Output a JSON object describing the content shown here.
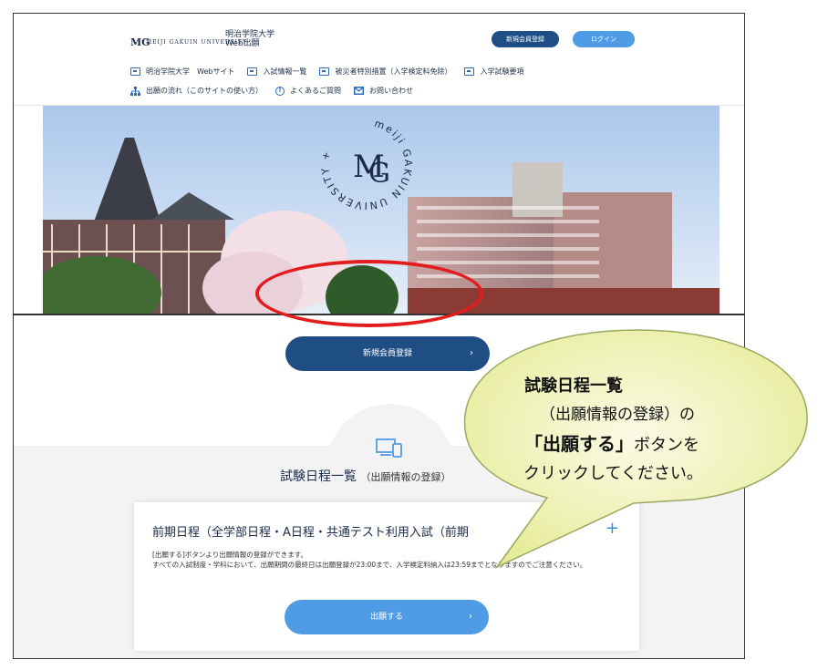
{
  "header": {
    "logo_mark": "MG",
    "logo_text": "MEIJI GAKUIN UNIVERSITY",
    "site_title": "明治学院大学\nWeb出願",
    "register_button": "新規会員登録",
    "login_button": "ログイン"
  },
  "nav": {
    "row1": [
      {
        "label": "明治学院大学　Webサイト",
        "icon": "window-icon"
      },
      {
        "label": "入試情報一覧",
        "icon": "window-icon"
      },
      {
        "label": "被災者特別措置（入学検定料免除）",
        "icon": "window-icon"
      },
      {
        "label": "入学試験要項",
        "icon": "window-icon"
      }
    ],
    "row2": [
      {
        "label": "出願の流れ（このサイトの使い方）",
        "icon": "flow-icon"
      },
      {
        "label": "よくあるご質問",
        "icon": "info-icon"
      },
      {
        "label": "お問い合わせ",
        "icon": "mail-icon"
      }
    ]
  },
  "hero": {
    "emblem_text": "meiji GAKUIN UNIVERSITY +",
    "emblem_mark": "MG"
  },
  "main": {
    "register_cta": "新規会員登録",
    "schedule_title": "試験日程一覧",
    "schedule_subtitle": "（出願情報の登録）",
    "card": {
      "title": "前期日程（全学部日程・A日程・共通テスト利用入試（前期",
      "line1": "[出願する]ボタンより出願情報の登録ができます。",
      "line2": "すべての入試制度・学科において、出願期間の最終日は出願登録が23:00まで、入学検定料納入は23:59までとなりますのでご注意ください。",
      "apply_button": "出願する"
    }
  },
  "callout": {
    "line1": "試験日程一覧",
    "line2": "（出願情報の登録）の",
    "line3_bold": "「出願する」",
    "line3_rest": "ボタンを",
    "line4": "クリックしてください。"
  },
  "colors": {
    "navy": "#1e4e84",
    "light_blue": "#4f9be6",
    "callout_fill": "#eef2b0",
    "highlight_red": "#e31d1d"
  }
}
